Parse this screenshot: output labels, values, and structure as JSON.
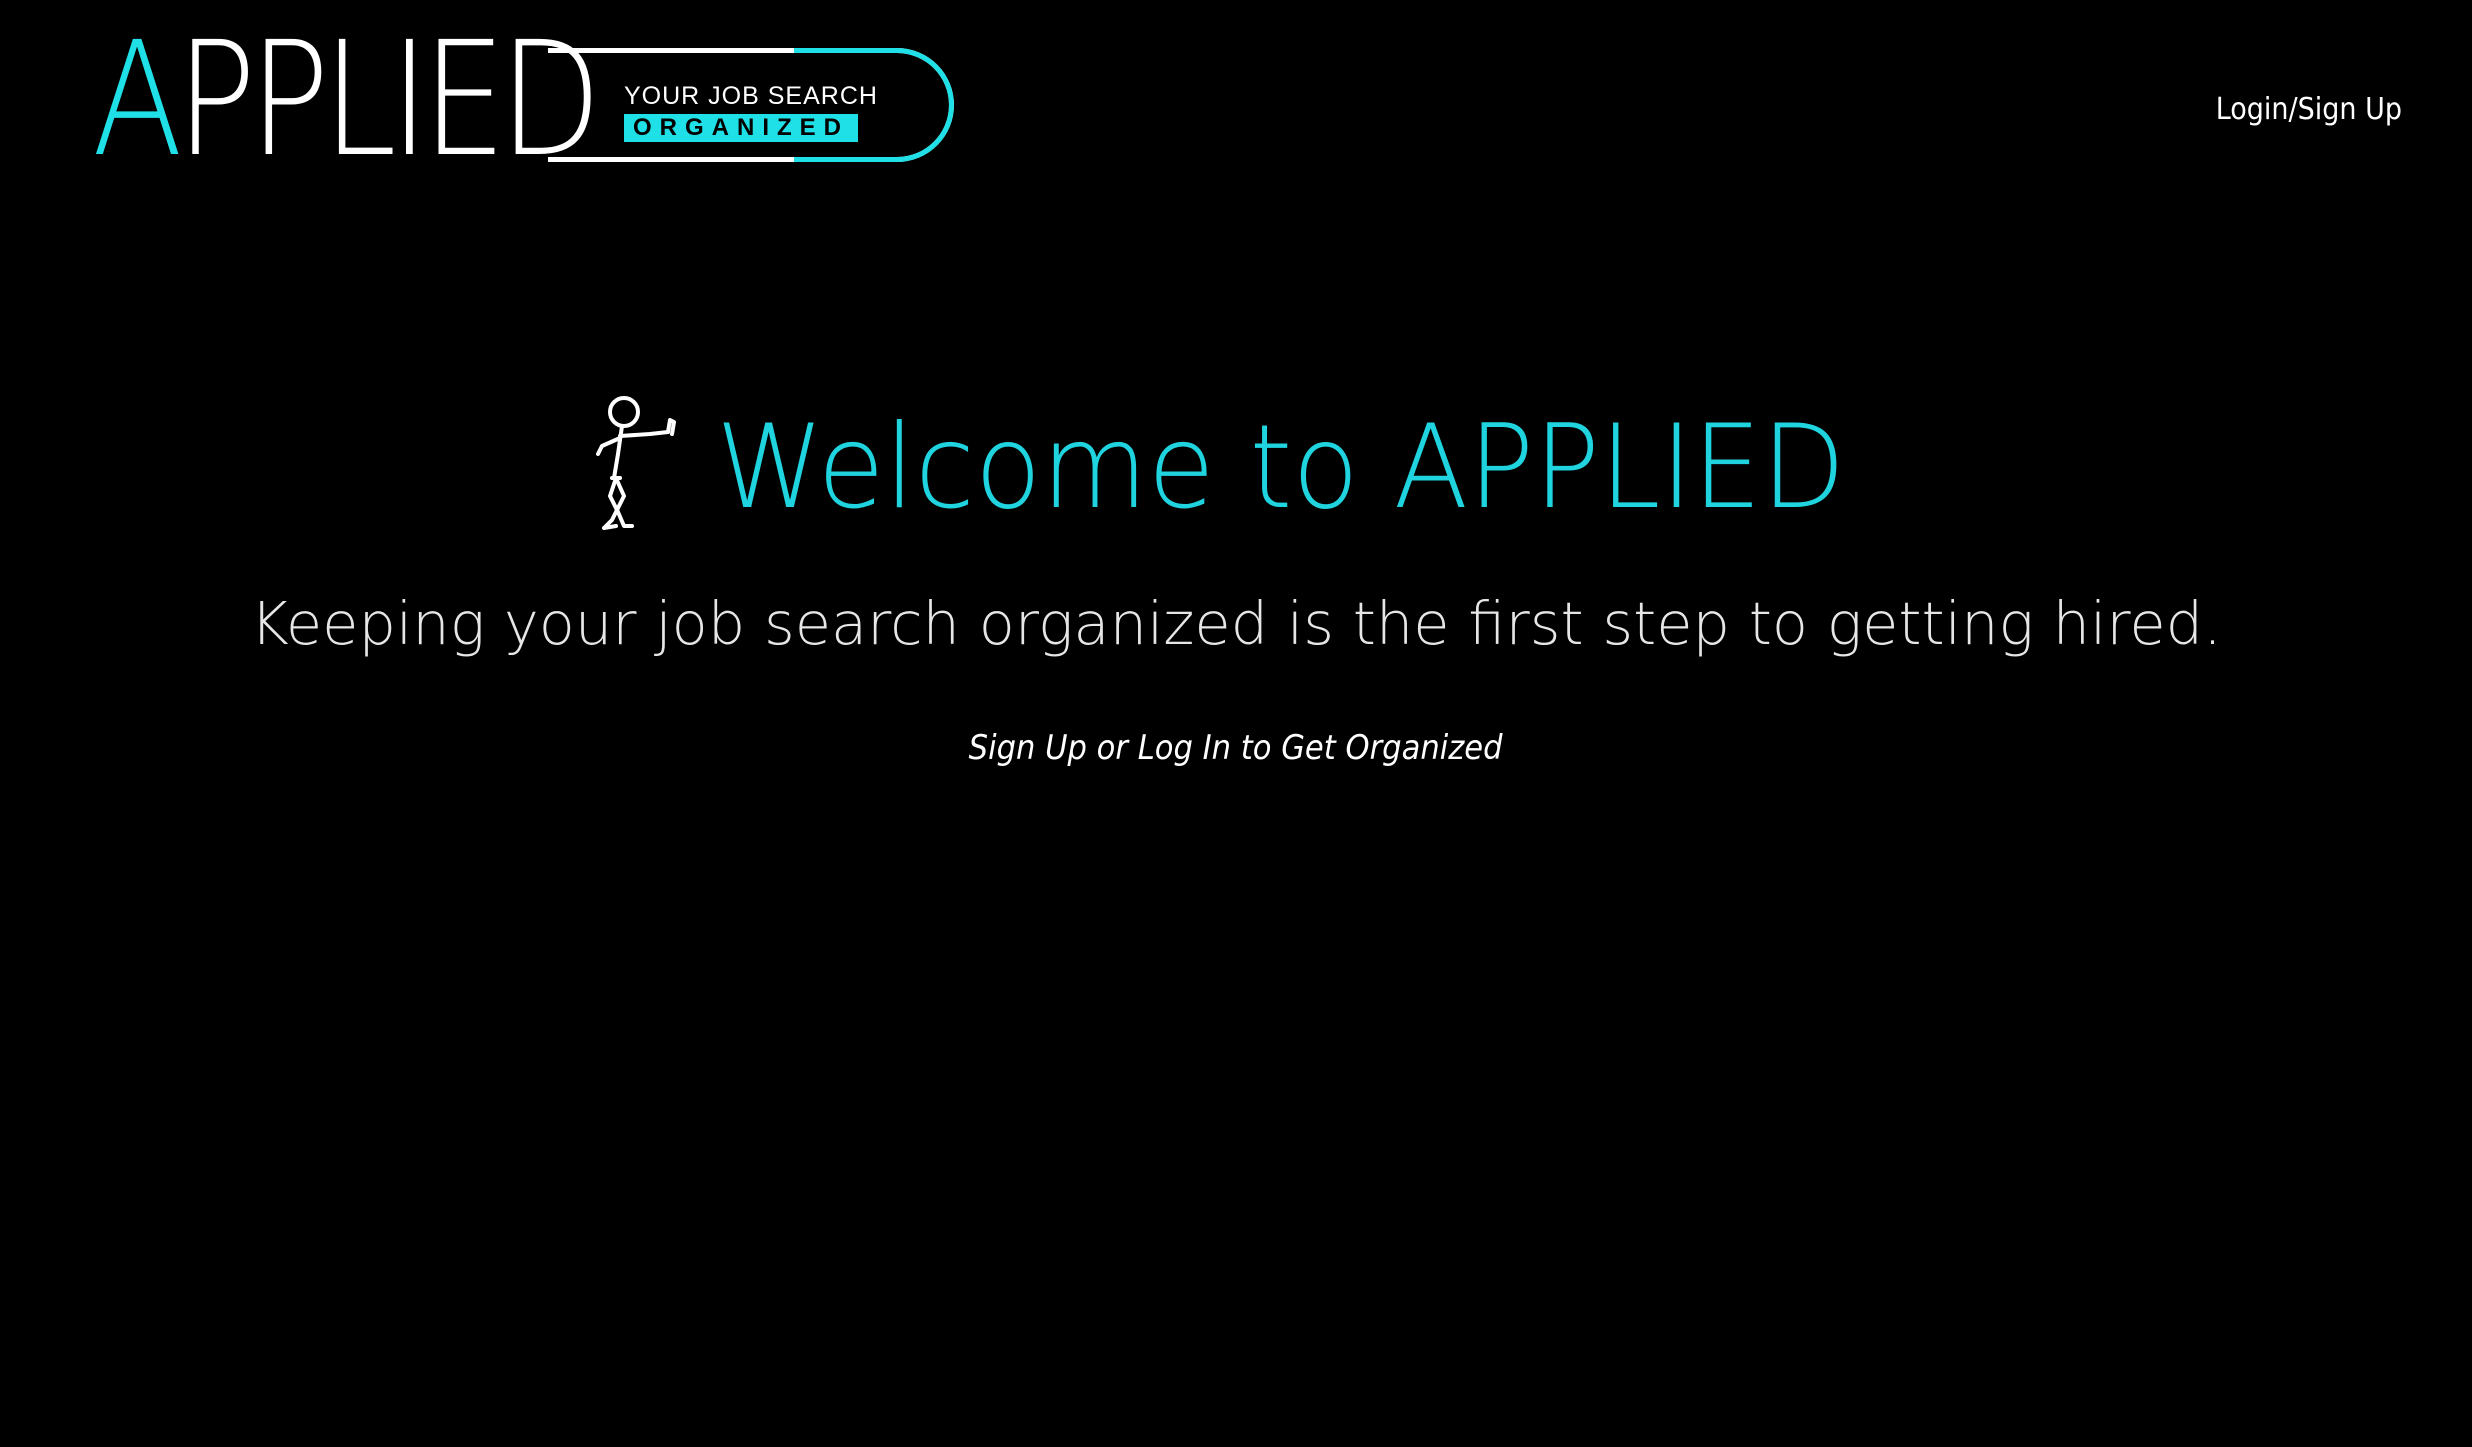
{
  "colors": {
    "background": "#000000",
    "accent": "#1fe0e6",
    "title": "#1fd3df",
    "text": "#ffffff"
  },
  "logo": {
    "letter_first": "A",
    "letters_rest": "PPLIED",
    "tagline_top": "YOUR JOB SEARCH",
    "tagline_bottom": "ORGANIZED"
  },
  "header": {
    "login_link": "Login/Sign Up"
  },
  "hero": {
    "figure_icon": "stick-figure-leaning-icon",
    "title": "Welcome to APPLIED",
    "subtitle": "Keeping your job search organized is the first step to getting hired.",
    "cta": "Sign Up or Log In to Get Organized"
  }
}
